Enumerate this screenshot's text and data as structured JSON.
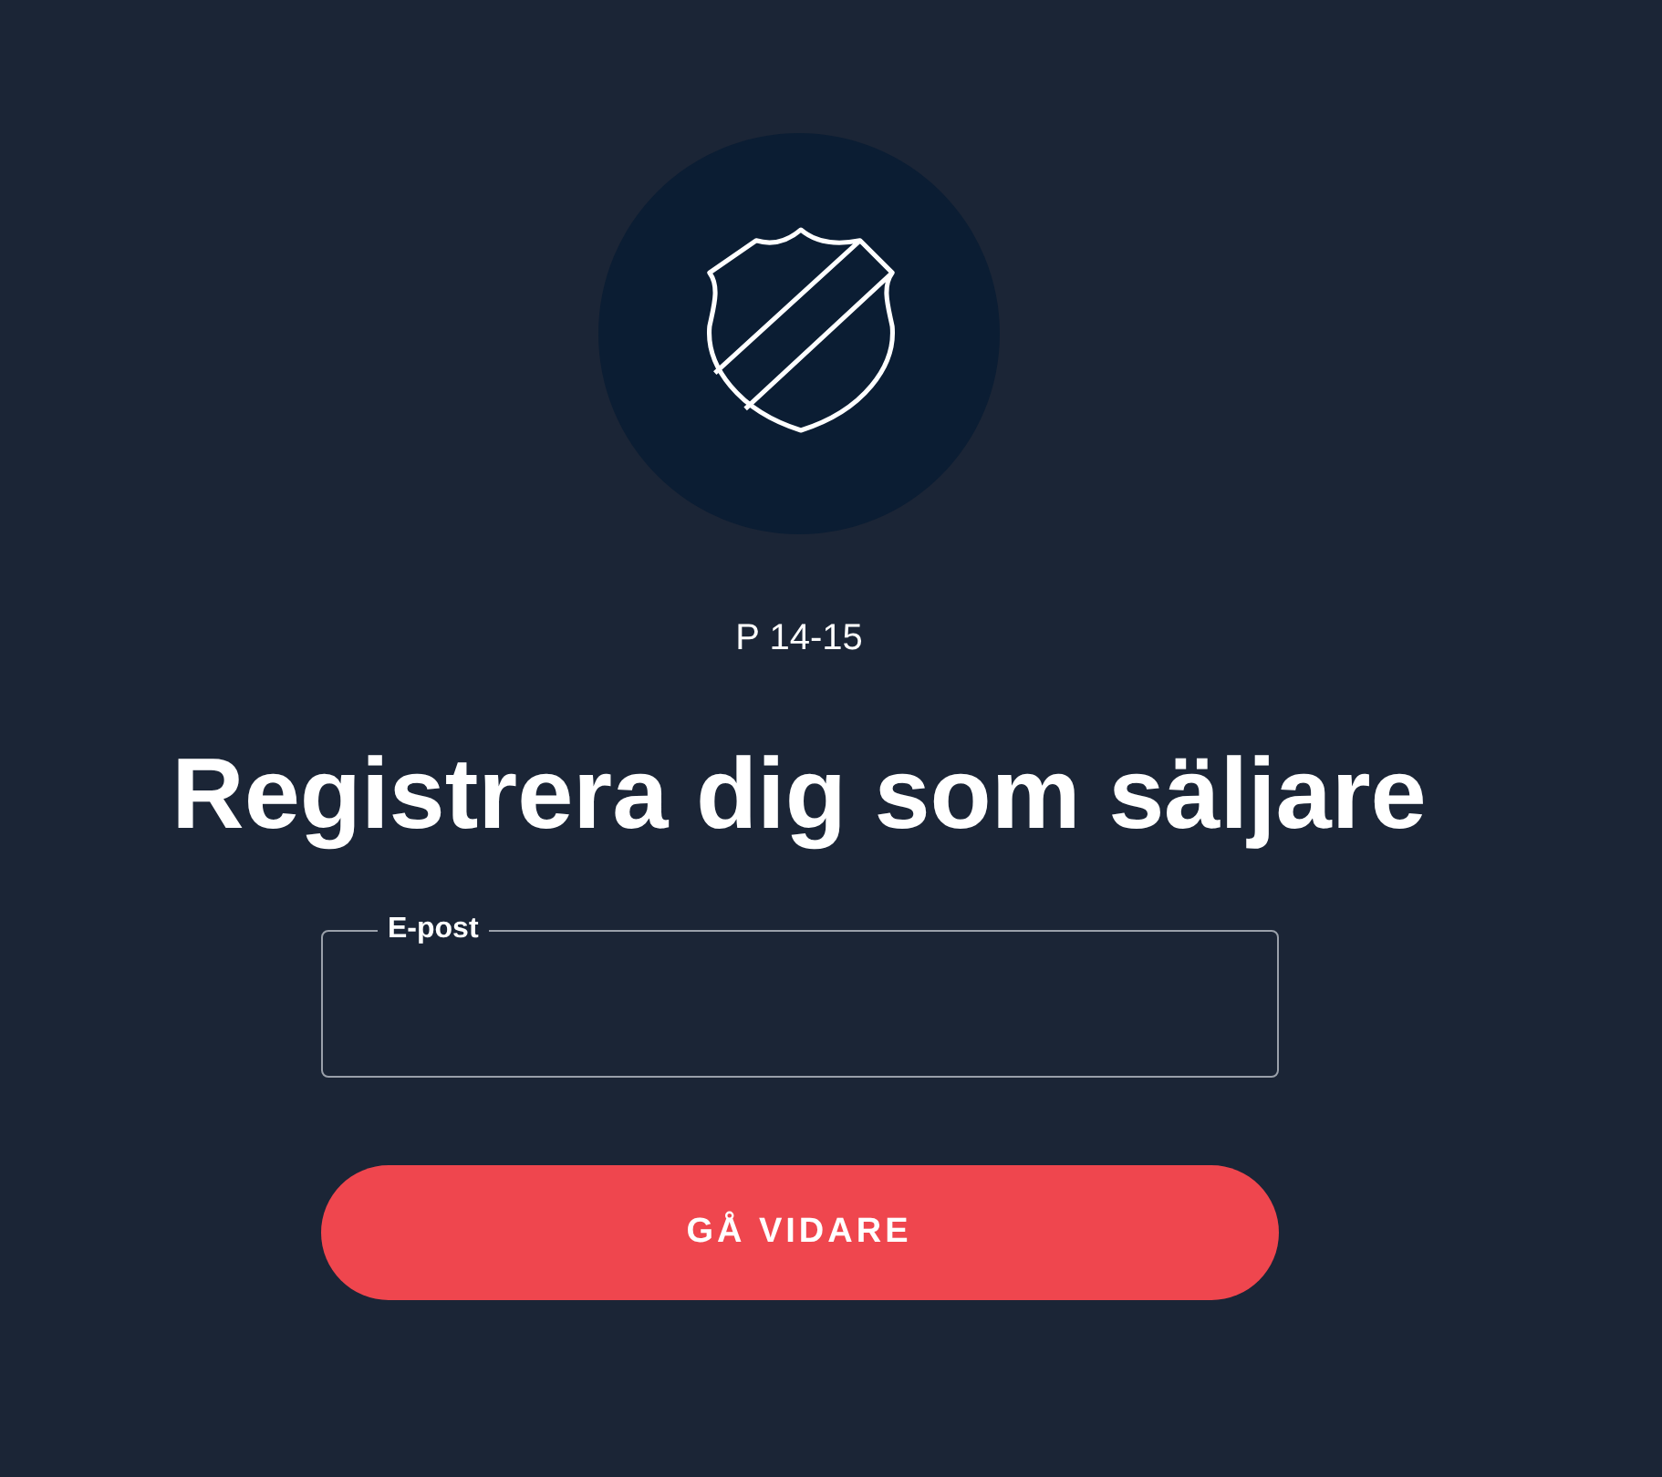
{
  "team": "P 14-15",
  "heading": "Registrera dig som säljare",
  "email_field": {
    "label": "E-post"
  },
  "submit_button": {
    "label": "GÅ VIDARE"
  }
}
